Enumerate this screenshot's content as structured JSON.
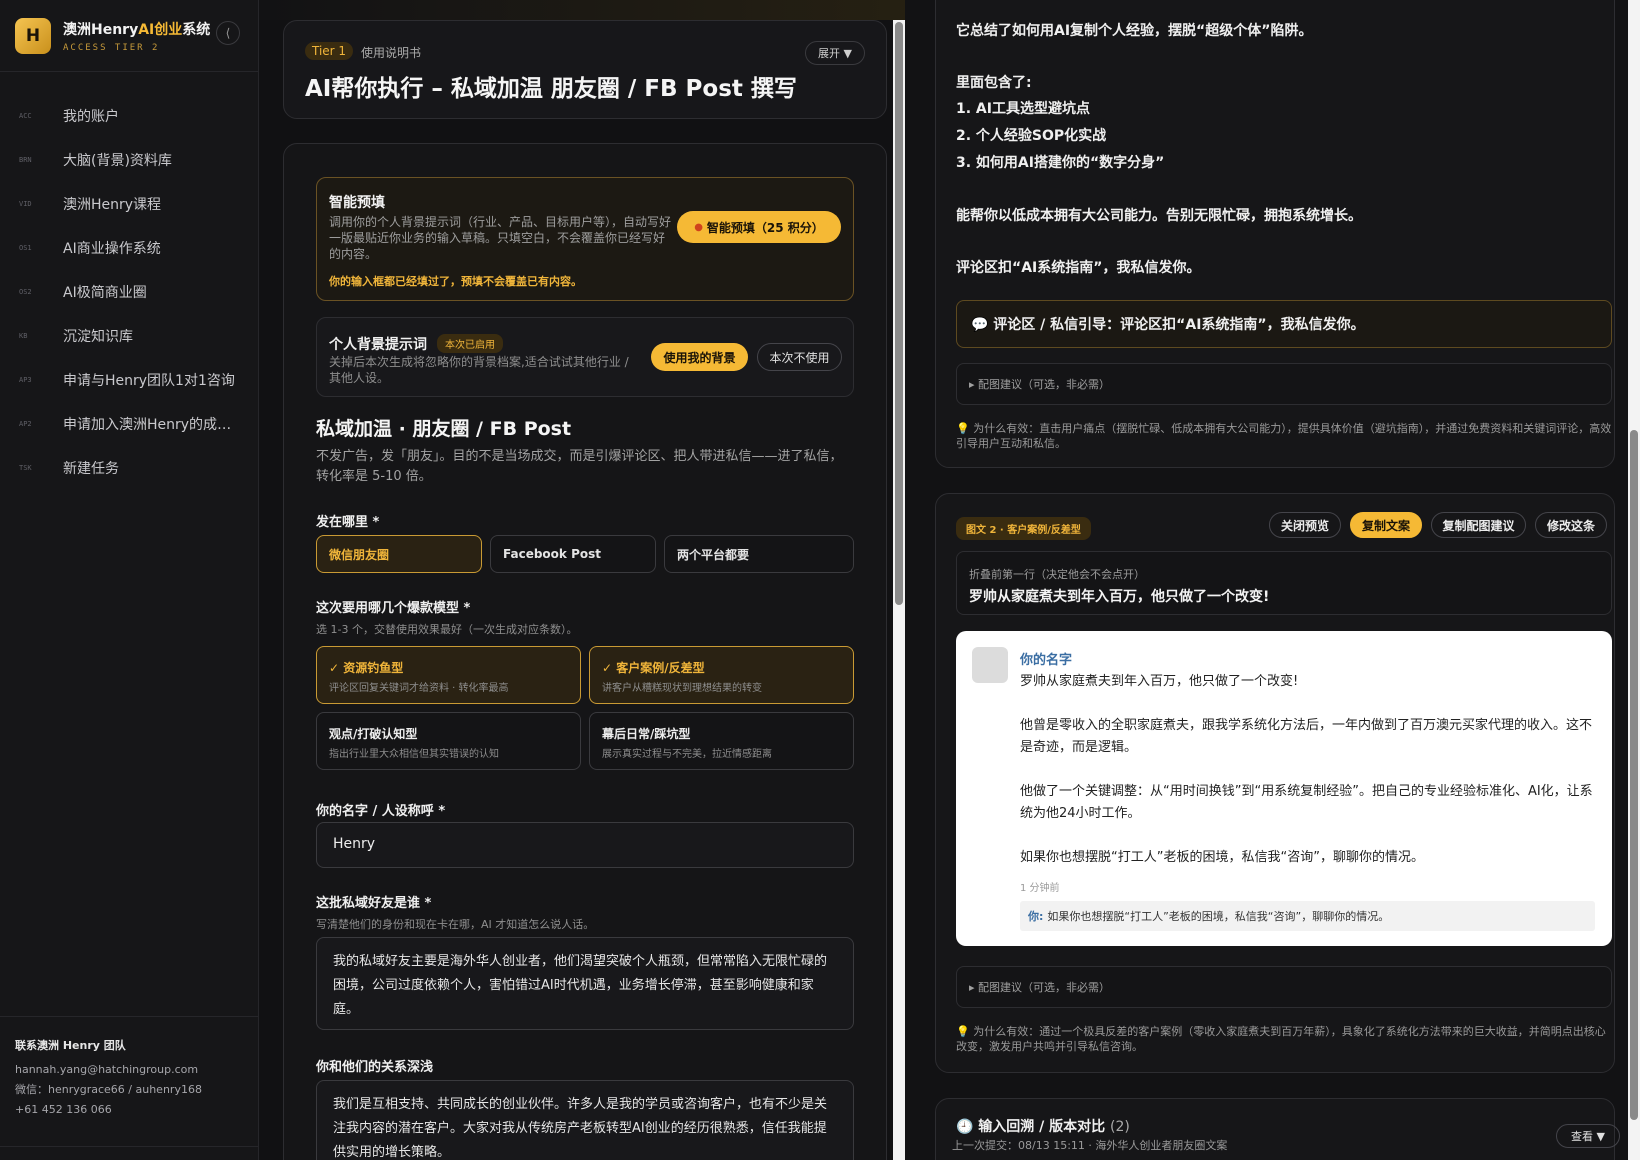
{
  "sidebar": {
    "logo_letter": "H",
    "brand_prefix": "澳洲Henry",
    "brand_highlight": "AI创业",
    "brand_suffix": "系统",
    "brand_sub": "ACCESS TIER 2",
    "collapse": "⟨",
    "items": [
      {
        "code": "ACC",
        "label": "我的账户"
      },
      {
        "code": "BRN",
        "label": "大脑(背景)资料库"
      },
      {
        "code": "VID",
        "label": "澳洲Henry课程"
      },
      {
        "code": "OS1",
        "label": "AI商业操作系统"
      },
      {
        "code": "OS2",
        "label": "AI极简商业圈"
      },
      {
        "code": "KB",
        "label": "沉淀知识库"
      },
      {
        "code": "AP3",
        "label": "申请与Henry团队1对1咨询"
      },
      {
        "code": "AP2",
        "label": "申请加入澳洲Henry的成长圈子"
      },
      {
        "code": "TSK",
        "label": "新建任务"
      }
    ],
    "contact": {
      "title": "联系澳洲 Henry 团队",
      "email": "hannah.yang@hatchingroup.com",
      "wechat": "微信：henrygrace66 / auhenry168",
      "phone": "+61 452 136 066"
    }
  },
  "header": {
    "tier": "Tier 1",
    "tier_desc": "使用说明书",
    "expand": "展开 ▼",
    "title": "AI帮你执行 – 私域加温 朋友圈 / FB Post 撰写"
  },
  "smart_fill": {
    "title": "智能预填",
    "desc": "调用你的个人背景提示词（行业、产品、目标用户等），自动写好一版最贴近你业务的输入草稿。只填空白，不会覆盖你已经写好的内容。",
    "warn": "你的输入框都已经填过了，预填不会覆盖已有内容。",
    "button": "智能预填（25 积分）"
  },
  "background_prompt": {
    "title": "个人背景提示词",
    "badge": "本次已启用",
    "desc": "关掉后本次生成将忽略你的背景档案,适合试试其他行业 / 其他人设。",
    "use": "使用我的背景",
    "skip": "本次不使用"
  },
  "section": {
    "title": "私域加温 · 朋友圈 / FB Post",
    "desc": "不发广告，发「朋友」。目的不是当场成交，而是引爆评论区、把人带进私信——进了私信，转化率是 5-10 倍。"
  },
  "platform": {
    "label": "发在哪里 *",
    "options": [
      "微信朋友圈",
      "Facebook Post",
      "两个平台都要"
    ]
  },
  "models": {
    "label": "这次要用哪几个爆款模型 *",
    "hint": "选 1-3 个，交替使用效果最好（一次生成对应条数）。",
    "items": [
      {
        "name": "✓ 资源钓鱼型",
        "desc": "评论区回复关键词才给资料 · 转化率最高"
      },
      {
        "name": "✓ 客户案例/反差型",
        "desc": "讲客户从糟糕现状到理想结果的转变"
      },
      {
        "name": "观点/打破认知型",
        "desc": "指出行业里大众相信但其实错误的认知"
      },
      {
        "name": "幕后日常/踩坑型",
        "desc": "展示真实过程与不完美，拉近情感距离"
      }
    ]
  },
  "name_field": {
    "label": "你的名字 / 人设称呼 *",
    "value": "Henry"
  },
  "audience": {
    "label": "这批私域好友是谁 *",
    "hint": "写清楚他们的身份和现在卡在哪，AI 才知道怎么说人话。",
    "value": "我的私域好友主要是海外华人创业者，他们渴望突破个人瓶颈，但常常陷入无限忙碌的困境，公司过度依赖个人，害怕错过AI时代机遇，业务增长停滞，甚至影响健康和家庭。"
  },
  "relationship": {
    "label": "你和他们的关系深浅",
    "value": "我们是互相支持、共同成长的创业伙伴。许多人是我的学员或咨询客户，也有不少是关注我内容的潜在客户。大家对我从传统房产老板转型AI创业的经历很熟悉，信任我能提供实用的增长策略。"
  },
  "post1": {
    "lines": [
      "它总结了如何用AI复制个人经验，摆脱“超级个体”陷阱。",
      "里面包含了:",
      "1. AI工具选型避坑点",
      "2. 个人经验SOP化实战",
      "3. 如何用AI搭建你的“数字分身”",
      "能帮你以低成本拥有大公司能力。告别无限忙碌，拥抱系统增长。",
      "评论区扣“AI系统指南”，我私信发你。"
    ],
    "cta": "💬 评论区 / 私信引导：评论区扣“AI系统指南”，我私信发你。",
    "image_suggest": "▸ 配图建议（可选，非必需）",
    "why": "💡 为什么有效：直击用户痛点（摆脱忙碌、低成本拥有大公司能力），提供具体价值（避坑指南），并通过免费资料和关键词评论，高效引导用户互动和私信。"
  },
  "post2": {
    "badge": "图文 2 · 客户案例/反差型",
    "buttons": [
      "关闭预览",
      "复制文案",
      "复制配图建议",
      "修改这条"
    ],
    "fold_hint": "折叠前第一行（决定他会不会点开）",
    "fold_line": "罗帅从家庭煮夫到年入百万，他只做了一个改变!",
    "preview": {
      "name": "你的名字",
      "paragraphs": [
        "罗帅从家庭煮夫到年入百万，他只做了一个改变!",
        "他曾是零收入的全职家庭煮夫，跟我学系统化方法后，一年内做到了百万澳元买家代理的收入。这不是奇迹，而是逻辑。",
        "他做了一个关键调整：从“用时间换钱”到“用系统复制经验”。把自己的专业经验标准化、AI化，让系统为他24小时工作。",
        "如果你也想摆脱“打工人”老板的困境，私信我“咨询”，聊聊你的情况。"
      ],
      "time": "1 分钟前",
      "comment_who": "你:",
      "comment_text": "如果你也想摆脱“打工人”老板的困境，私信我“咨询”，聊聊你的情况。"
    },
    "image_suggest": "▸ 配图建议（可选，非必需）",
    "why": "💡 为什么有效：通过一个极具反差的客户案例（零收入家庭煮夫到百万年薪），具象化了系统化方法带来的巨大收益，并简明点出核心改变，激发用户共鸣并引导私信咨询。"
  },
  "history": {
    "title": "🕘 输入回溯 / 版本对比",
    "count": "(2)",
    "sub": "上一次提交：08/13 15:11 · 海外华人创业者朋友圈文案",
    "button": "查看 ▼"
  }
}
